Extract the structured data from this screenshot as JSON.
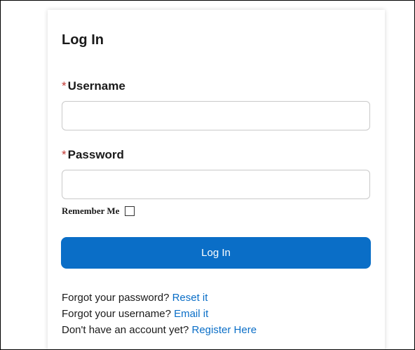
{
  "form": {
    "title": "Log In",
    "required_marker": "*",
    "username_label": "Username",
    "username_value": "",
    "password_label": "Password",
    "password_value": "",
    "remember_label": "Remember Me",
    "remember_checked": false,
    "submit_label": "Log In"
  },
  "help": {
    "forgot_password_text": "Forgot your password?",
    "forgot_password_link": "Reset it",
    "forgot_username_text": "Forgot your username?",
    "forgot_username_link": "Email it",
    "no_account_text": "Don't have an account yet?",
    "no_account_link": "Register Here"
  },
  "colors": {
    "primary": "#0a6ec7",
    "required": "#c23934",
    "text": "#1a1a1a"
  }
}
